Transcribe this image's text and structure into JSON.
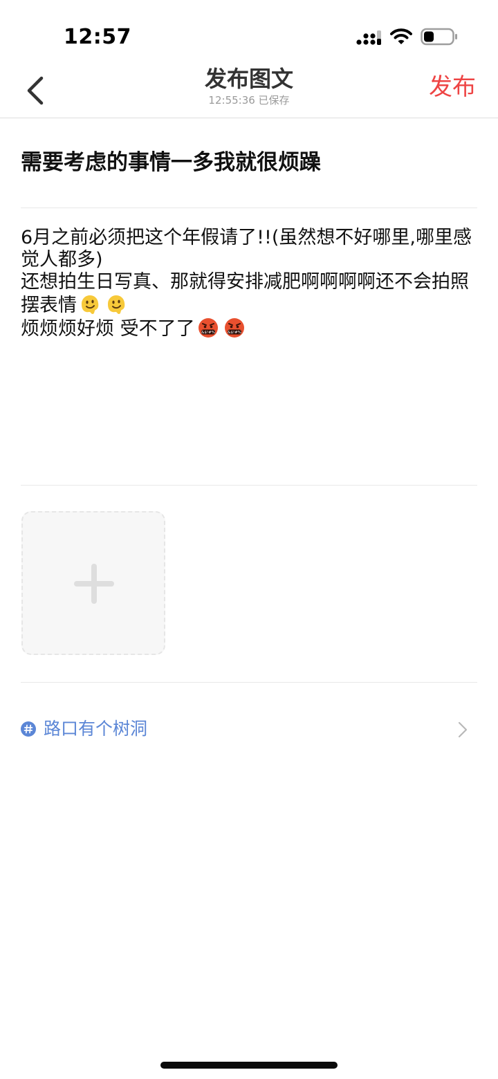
{
  "status_bar": {
    "time": "12:57"
  },
  "header": {
    "back_icon": "chevron-left-icon",
    "title": "发布图文",
    "save_status": "12:55:36 已保存",
    "publish_label": "发布",
    "publish_color": "#ee4444"
  },
  "post": {
    "title": "需要考虑的事情一多我就很烦躁",
    "body": {
      "line1": "6月之前必须把这个年假请了!!(虽然想不好哪里,哪里感觉人都多)",
      "line2": "还想拍生日写真、那就得安排减肥啊啊啊啊还不会拍照摆表情",
      "line2_emojis": [
        "melting-face-emoji",
        "melting-face-emoji"
      ],
      "line3": "烦烦烦好烦 受不了了",
      "line3_emojis": [
        "face-with-symbols-on-mouth-emoji",
        "face-with-symbols-on-mouth-emoji"
      ]
    }
  },
  "add_image": {
    "icon": "plus-icon"
  },
  "topic": {
    "icon": "hash-icon",
    "label": "路口有个树洞",
    "color": "#5b86d6",
    "chevron_icon": "chevron-right-icon"
  }
}
